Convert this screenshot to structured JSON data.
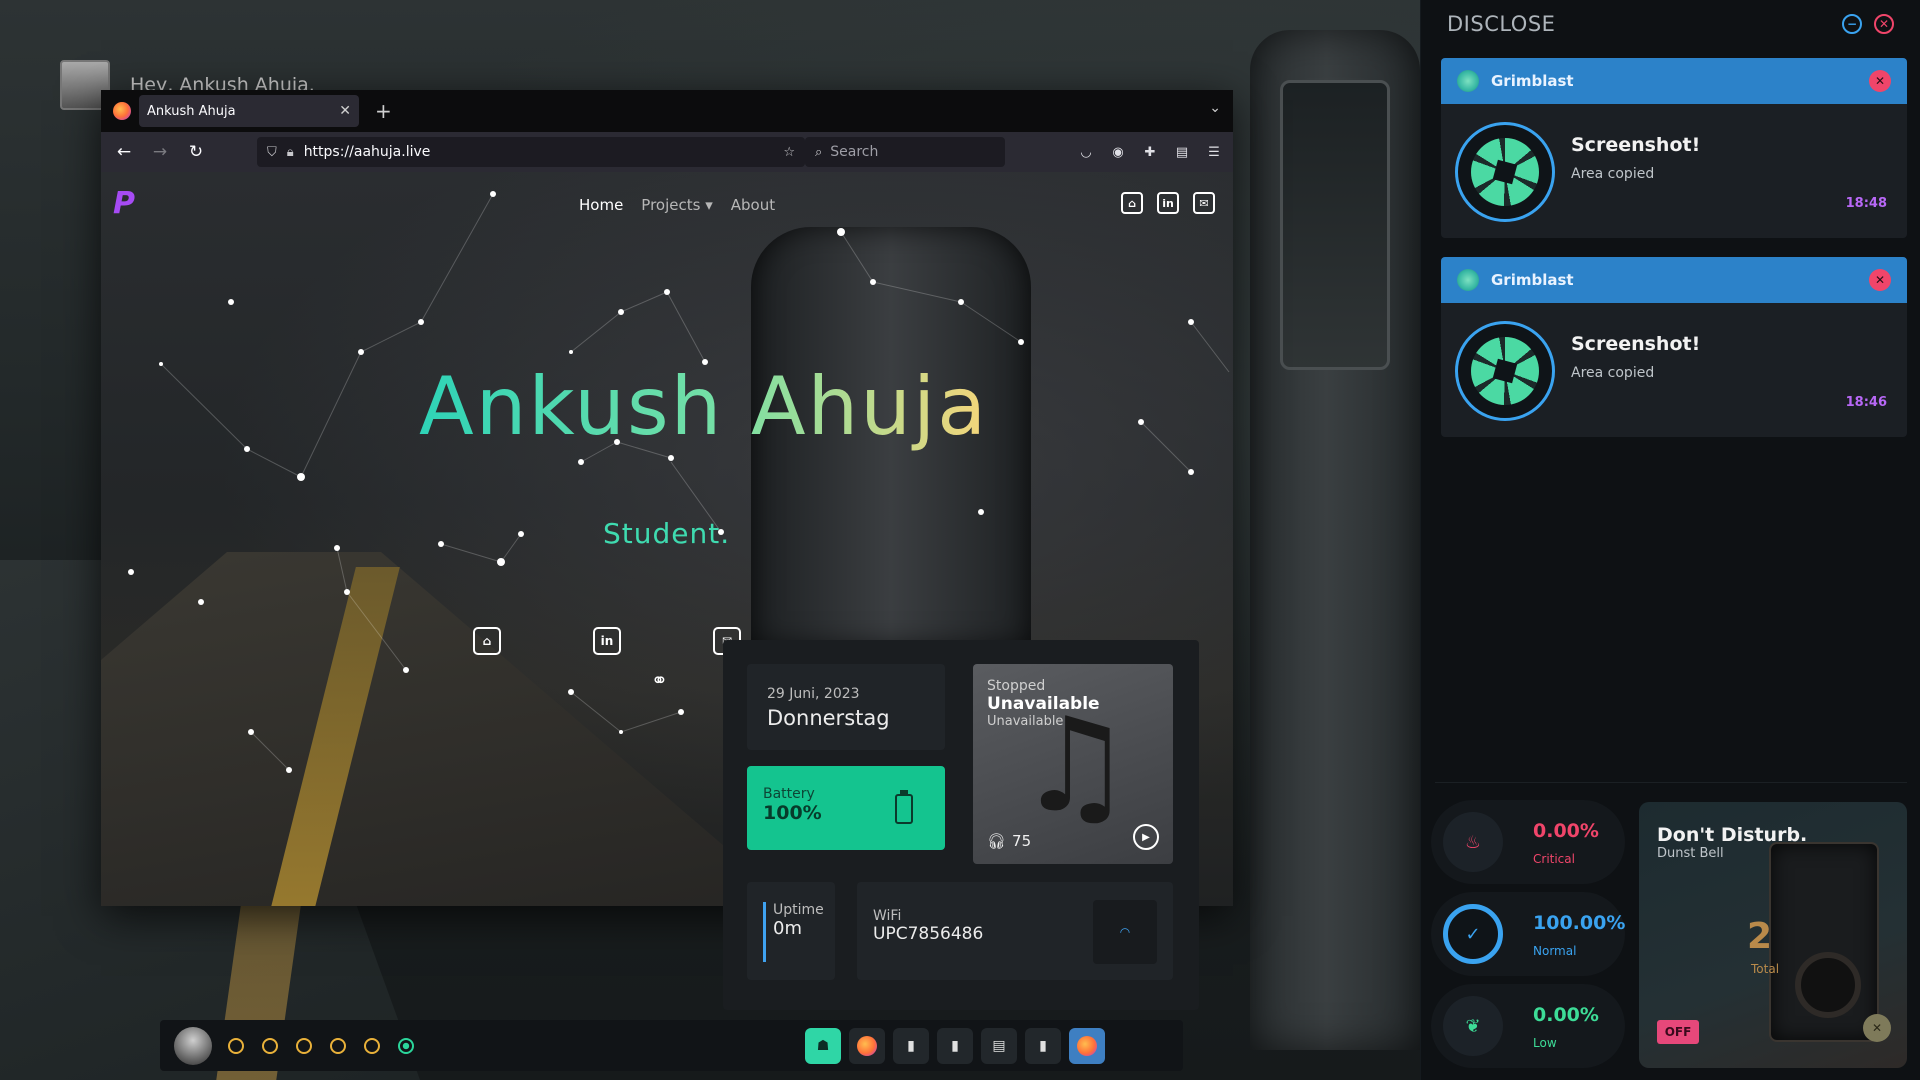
{
  "greeting": "Hey, Ankush Ahuja.",
  "browser": {
    "tab_title": "Ankush Ahuja",
    "new_tab": "+",
    "url": "https://aahuja.live",
    "search_placeholder": "Search"
  },
  "site": {
    "logo": "P",
    "nav": {
      "home": "Home",
      "projects": "Projects",
      "about": "About"
    },
    "hero_name": "Ankush Ahuja",
    "hero_sub": "Student."
  },
  "dashboard": {
    "date": "29 Juni, 2023",
    "day": "Donnerstag",
    "battery_label": "Battery",
    "battery_value": "100%",
    "music_state": "Stopped",
    "music_title": "Unavailable",
    "music_artist": "Unavailable",
    "music_volume": "75",
    "uptime_label": "Uptime",
    "uptime_value": "0m",
    "wifi_label": "WiFi",
    "wifi_value": "UPC7856486"
  },
  "taskbar": {
    "workspaces": [
      {
        "active": false
      },
      {
        "active": false
      },
      {
        "active": false
      },
      {
        "active": false
      },
      {
        "active": false
      },
      {
        "active": true
      }
    ],
    "apps": [
      "ghost",
      "firefox",
      "terminal",
      "terminal",
      "files",
      "terminal",
      "firefox-active"
    ]
  },
  "sidebar": {
    "title": "DISCLOSE",
    "notifications": [
      {
        "app": "Grimblast",
        "summary": "Screenshot!",
        "body": "Area copied",
        "time": "18:48"
      },
      {
        "app": "Grimblast",
        "summary": "Screenshot!",
        "body": "Area copied",
        "time": "18:46"
      }
    ],
    "stats": {
      "critical": {
        "value": "0.00%",
        "label": "Critical"
      },
      "normal": {
        "value": "100.00%",
        "label": "Normal"
      },
      "low": {
        "value": "0.00%",
        "label": "Low"
      }
    },
    "dnd": {
      "title": "Don't Disturb.",
      "subtitle": "Dunst Bell",
      "count": "2",
      "count_label": "Total",
      "toggle": "OFF"
    }
  },
  "colors": {
    "accent_blue": "#2c82c9",
    "critical": "#f0456a",
    "normal": "#3aa3f0",
    "low": "#3ddc97",
    "battery": "#14c48f",
    "time": "#b868f6"
  }
}
